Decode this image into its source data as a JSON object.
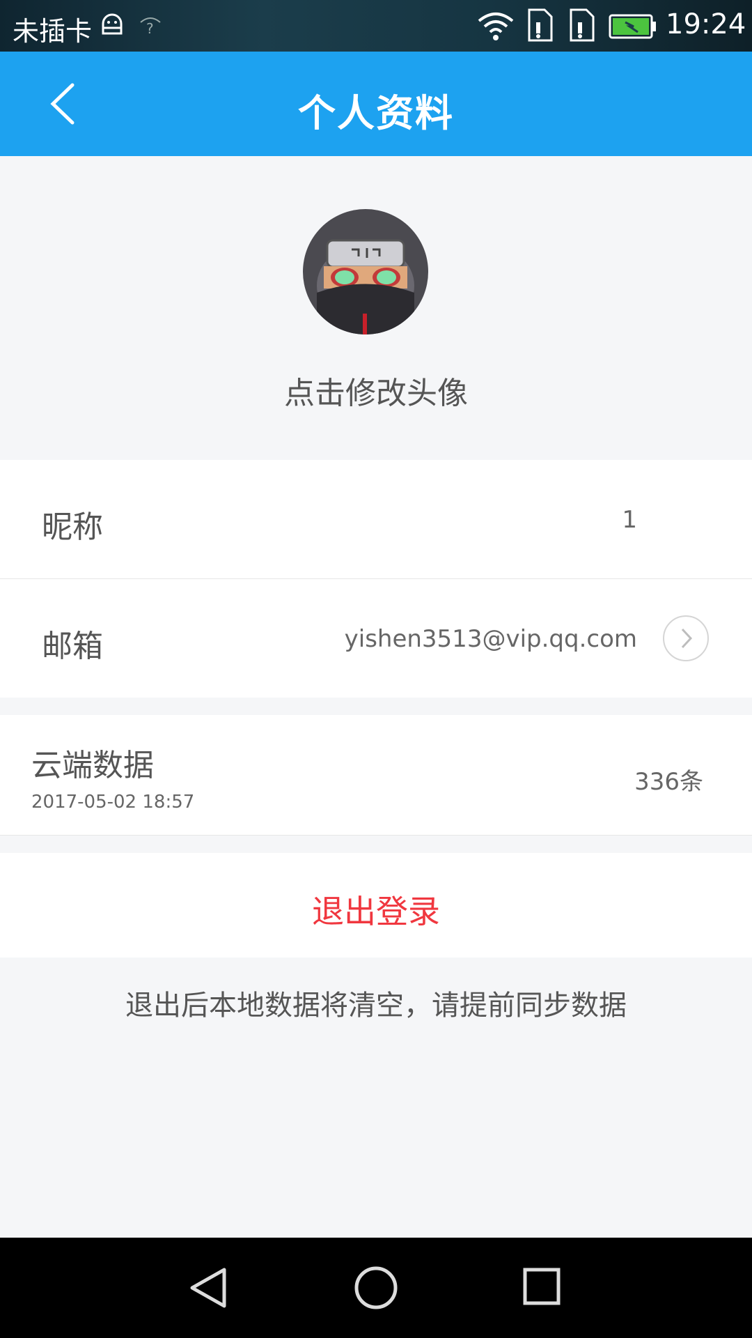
{
  "status_bar": {
    "carrier": "未插卡",
    "time": "19:24",
    "icons": [
      "android-icon",
      "question-icon",
      "wifi-icon",
      "sim1-icon",
      "sim2-icon",
      "battery-icon"
    ]
  },
  "app_bar": {
    "title": "个人资料",
    "back_icon": "chevron-left-icon"
  },
  "avatar": {
    "hint": "点击修改头像"
  },
  "profile": {
    "nickname_label": "昵称",
    "nickname_value": "1",
    "email_label": "邮箱",
    "email_value": "yishen3513@vip.qq.com",
    "email_arrow_icon": "chevron-right-circle-icon"
  },
  "cloud": {
    "label": "云端数据",
    "timestamp": "2017-05-02 18:57",
    "count": "336条"
  },
  "logout": {
    "label": "退出登录",
    "notice": "退出后本地数据将清空，请提前同步数据"
  },
  "colors": {
    "app_bar": "#1da2f0",
    "logout_text": "#f0373f",
    "page_bg": "#f5f6f8"
  },
  "nav_bar": {
    "icons": [
      "back-triangle-icon",
      "home-circle-icon",
      "recents-square-icon"
    ]
  }
}
